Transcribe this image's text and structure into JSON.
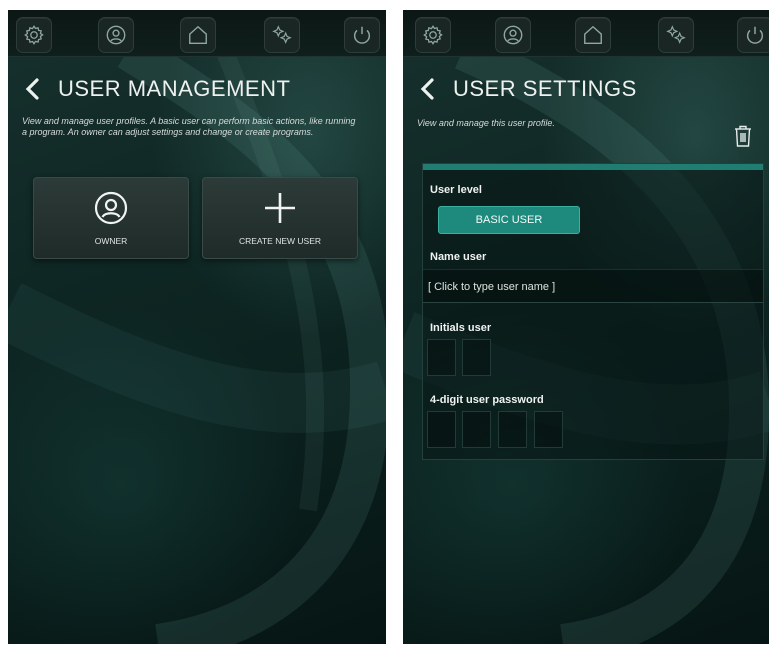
{
  "left": {
    "title": "USER MANAGEMENT",
    "description": "View and manage user profiles. A basic user can perform basic actions, like running a program. An owner can adjust settings and change or create programs.",
    "cards": [
      {
        "label": "OWNER",
        "icon": "user-circle-icon"
      },
      {
        "label": "CREATE NEW USER",
        "icon": "plus-icon"
      }
    ]
  },
  "right": {
    "title": "USER SETTINGS",
    "description": "View and manage this user profile.",
    "user_level_label": "User level",
    "user_level_value": "BASIC USER",
    "name_label": "Name user",
    "name_placeholder": "[ Click to type user name ]",
    "initials_label": "Initials user",
    "password_label": "4-digit user password"
  },
  "topbar_icons": [
    "settings-icon",
    "user-icon",
    "home-icon",
    "sparkle-icon",
    "power-icon"
  ],
  "colors": {
    "accent": "#1d8a7d",
    "background": "#0e2623"
  }
}
